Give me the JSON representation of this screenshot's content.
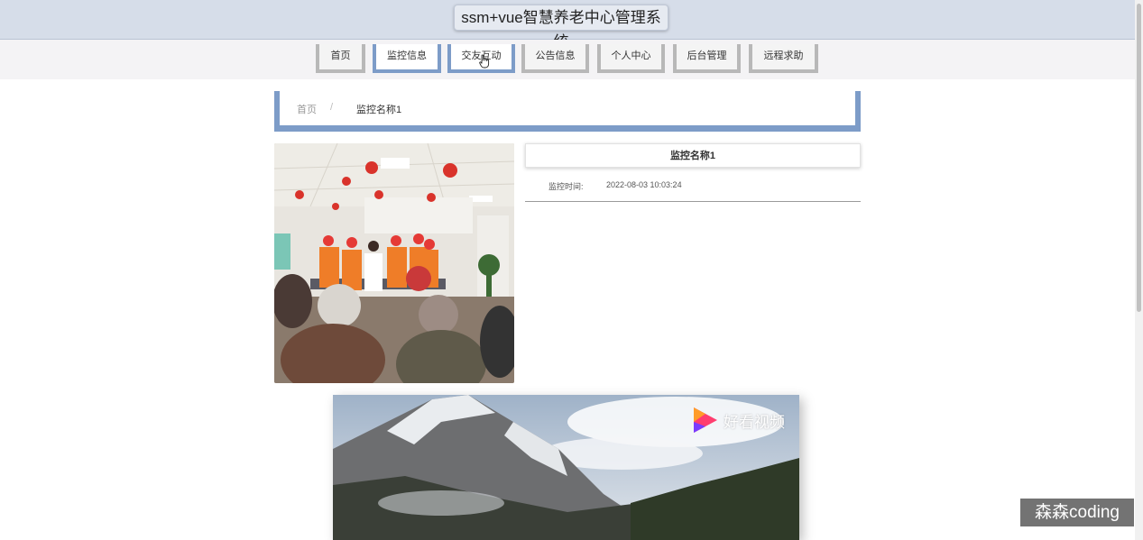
{
  "header": {
    "title": "ssm+vue智慧养老中心管理系统"
  },
  "nav": {
    "items": [
      {
        "label": "首页",
        "active": false
      },
      {
        "label": "监控信息",
        "active": true
      },
      {
        "label": "交友互动",
        "active": true
      },
      {
        "label": "公告信息",
        "active": false
      },
      {
        "label": "个人中心",
        "active": false
      },
      {
        "label": "后台管理",
        "active": false
      },
      {
        "label": "远程求助",
        "active": false
      }
    ]
  },
  "breadcrumb": {
    "home": "首页",
    "separator": "/",
    "current": "监控名称1"
  },
  "detail": {
    "title": "监控名称1",
    "time_label": "监控时间:",
    "time_value": "2022-08-03 10:03:24"
  },
  "video": {
    "brand": "好看视频"
  },
  "watermark": {
    "text": "森森coding"
  },
  "colors": {
    "accent": "#7d9cc8",
    "header_bg": "#d6dde9",
    "nav_bg": "#f4f3f5"
  }
}
